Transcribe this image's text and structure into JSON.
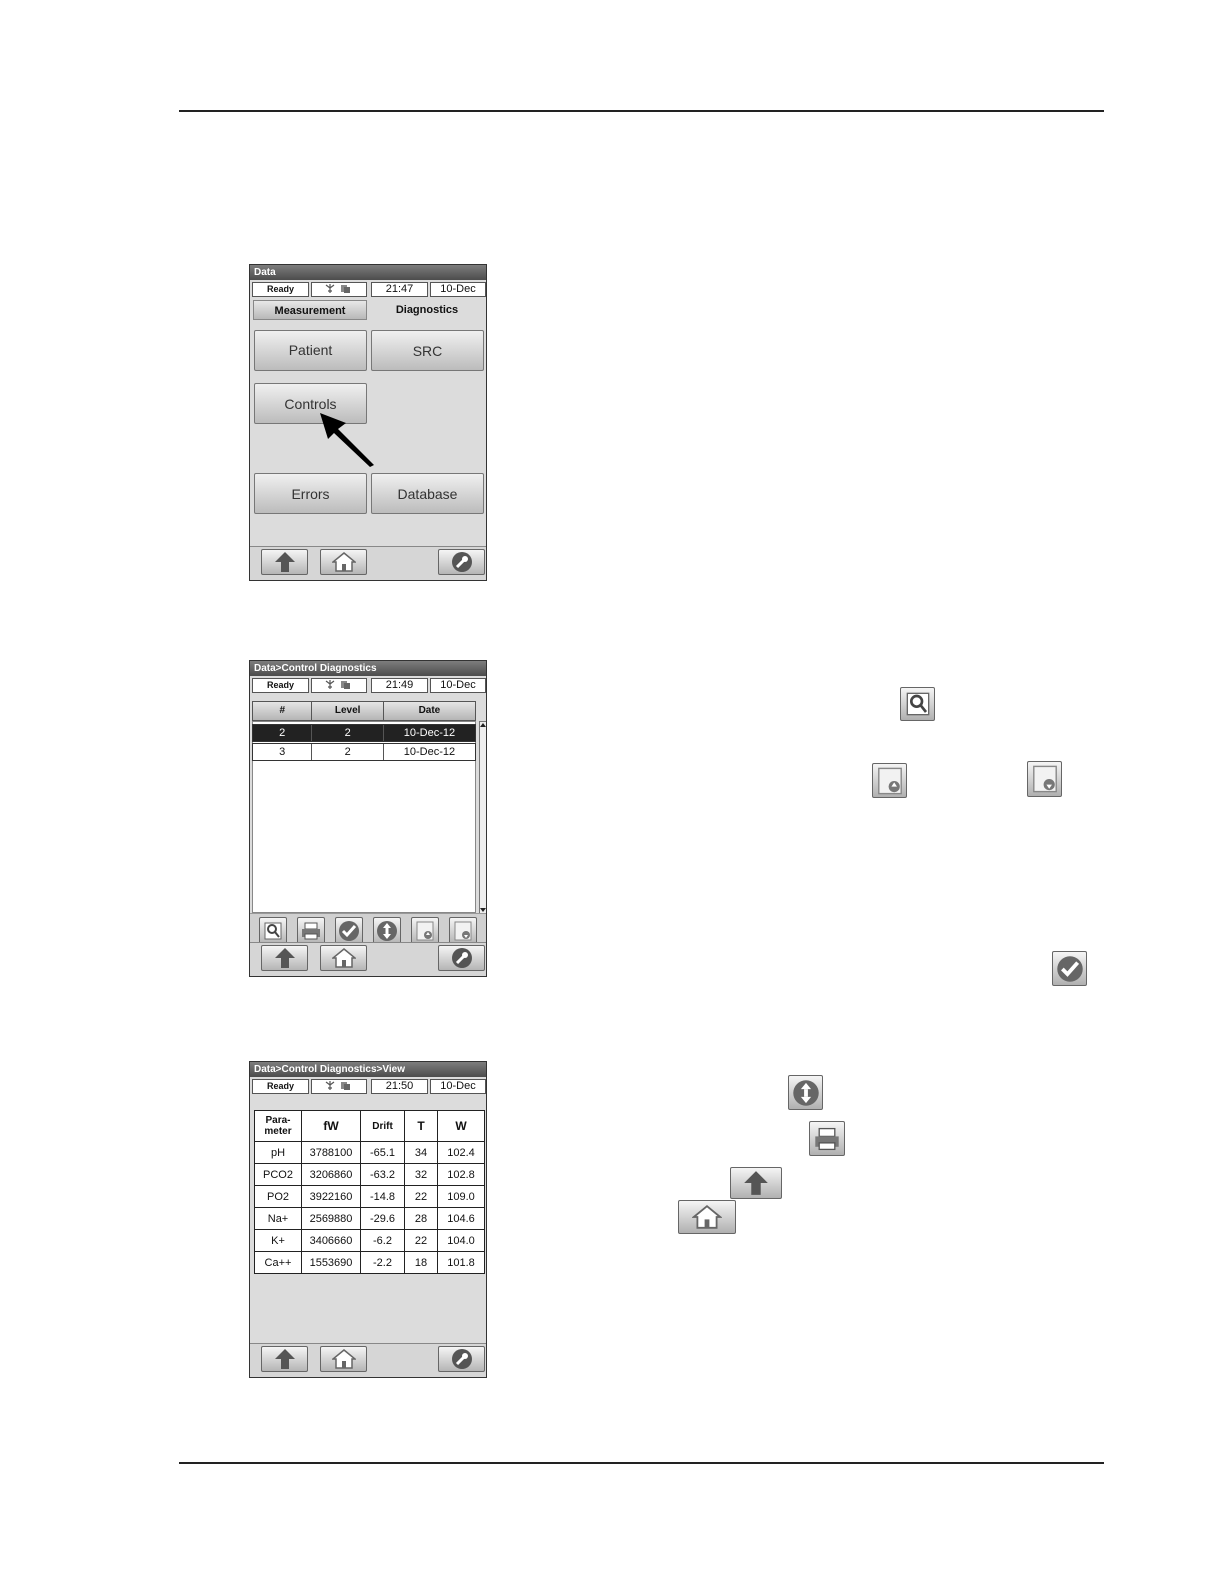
{
  "screens": {
    "data": {
      "title": "Data",
      "status": {
        "ready": "Ready",
        "time": "21:47",
        "date": "10-Dec"
      },
      "tabs": {
        "measurement": "Measurement",
        "diagnostics": "Diagnostics"
      },
      "buttons": {
        "patient": "Patient",
        "src": "SRC",
        "controls": "Controls",
        "errors": "Errors",
        "database": "Database"
      }
    },
    "control_diagnostics": {
      "title": "Data>Control Diagnostics",
      "status": {
        "ready": "Ready",
        "time": "21:49",
        "date": "10-Dec"
      },
      "columns": [
        "#",
        "Level",
        "Date"
      ],
      "rows": [
        {
          "num": "2",
          "level": "2",
          "date": "10-Dec-12"
        },
        {
          "num": "3",
          "level": "2",
          "date": "10-Dec-12"
        }
      ]
    },
    "view": {
      "title": "Data>Control Diagnostics>View",
      "status": {
        "ready": "Ready",
        "time": "21:50",
        "date": "10-Dec"
      },
      "columns": {
        "param_line1": "Para-",
        "param_line2": "meter",
        "fw": "fW",
        "drift": "Drift",
        "t": "T",
        "w": "W"
      },
      "rows": [
        {
          "param": "pH",
          "fw": "3788100",
          "drift": "-65.1",
          "t": "34",
          "w": "102.4"
        },
        {
          "param": "PCO2",
          "fw": "3206860",
          "drift": "-63.2",
          "t": "32",
          "w": "102.8"
        },
        {
          "param": "PO2",
          "fw": "3922160",
          "drift": "-14.8",
          "t": "22",
          "w": "109.0"
        },
        {
          "param": "Na+",
          "fw": "2569880",
          "drift": "-29.6",
          "t": "28",
          "w": "104.6"
        },
        {
          "param": "K+",
          "fw": "3406660",
          "drift": "-6.2",
          "t": "22",
          "w": "104.0"
        },
        {
          "param": "Ca++",
          "fw": "1553690",
          "drift": "-2.2",
          "t": "18",
          "w": "101.8"
        }
      ]
    }
  },
  "icons": [
    "arrow-up-icon",
    "home-icon",
    "wrench-icon",
    "magnifier-icon",
    "printer-icon",
    "checkmark-icon",
    "up-down-arrows-icon",
    "page-up-icon",
    "page-down-icon"
  ]
}
